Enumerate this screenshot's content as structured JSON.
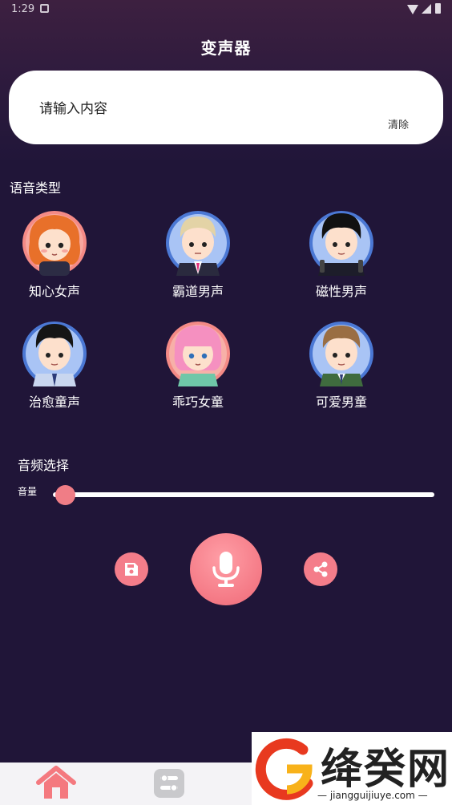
{
  "status_bar": {
    "time": "1:29"
  },
  "header": {
    "title": "变声器"
  },
  "input": {
    "placeholder": "请输入内容",
    "value": "",
    "clear_label": "清除"
  },
  "voice_section": {
    "title": "语音类型",
    "voices": [
      {
        "label": "知心女声",
        "avatar": "avatar-orange-hair-girl-icon"
      },
      {
        "label": "霸道男声",
        "avatar": "avatar-blond-boy-icon"
      },
      {
        "label": "磁性男声",
        "avatar": "avatar-black-hair-boy-headphones-icon"
      },
      {
        "label": "治愈童声",
        "avatar": "avatar-black-hair-boy-tie-icon"
      },
      {
        "label": "乖巧女童",
        "avatar": "avatar-pink-hair-girl-icon"
      },
      {
        "label": "可爱男童",
        "avatar": "avatar-brown-hair-boy-vest-icon"
      }
    ]
  },
  "audio_section": {
    "title": "音频选择",
    "volume_label": "音量",
    "volume_level": 0.03
  },
  "controls": {
    "save_icon": "save-icon",
    "mic_icon": "microphone-icon",
    "share_icon": "share-icon"
  },
  "tab_bar": {
    "items": [
      "home-icon",
      "tools-icon"
    ]
  },
  "watermark": {
    "text": "绛癸网",
    "url": "— jiangguijiuye.com —"
  },
  "colors": {
    "background": "#201538",
    "accent": "#f47d8a",
    "card": "#ffffff"
  }
}
